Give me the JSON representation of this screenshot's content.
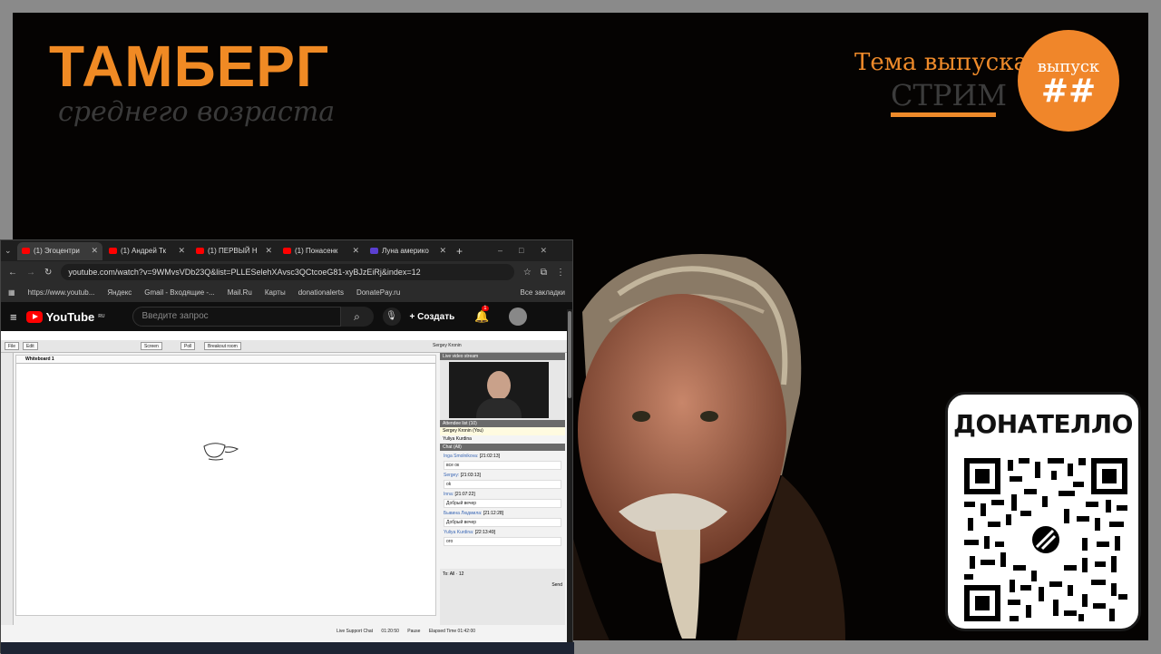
{
  "overlay": {
    "brand_title": "ТАМБЕРГ",
    "brand_subtitle": "среднего возраста",
    "topic_label": "Тема выпуска:",
    "topic_value": "СТРИМ",
    "badge_label": "выпуск",
    "badge_number": "##",
    "donate_title": "ДОНАТЕЛЛО"
  },
  "browser": {
    "tabs": [
      {
        "label": "(1) Эгоцентри",
        "active": true
      },
      {
        "label": "(1) Андрей Тк",
        "active": false
      },
      {
        "label": "(1) ПЕРВЫЙ Н",
        "active": false
      },
      {
        "label": "(1) Понасенк",
        "active": false
      },
      {
        "label": "Луна америко",
        "active": false
      }
    ],
    "url": "youtube.com/watch?v=9WMvsVDb23Q&list=PLLESelehXAvsc3QCtcoeG81-xyBJzEiRj&index=12",
    "bookmarks": [
      "https://www.youtub...",
      "Яндекс",
      "Gmail - Входящие -...",
      "Mail.Ru",
      "Карты",
      "donationalerts",
      "DonatePay.ru",
      "Все закладки"
    ]
  },
  "youtube": {
    "logo": "YouTube",
    "region": "RU",
    "search_placeholder": "Введите запрос",
    "create_label": "Создать",
    "notification_count": "1"
  },
  "whiteboard": {
    "toolbar": [
      "File",
      "Edit",
      "Screen",
      "Poll",
      "Breakout room"
    ],
    "tab": "Whiteboard 1",
    "user": "Sergey Kronin",
    "live_title": "Live video stream",
    "attendee_title": "Attendee list (10)",
    "attendees": [
      "Sergey Kronin (You)",
      "Yuliya Kurdina"
    ],
    "chat_title": "Chat (All)",
    "chat": [
      {
        "name": "Inga Smolnikova:",
        "time": "[21:02:13]",
        "text": "все ок"
      },
      {
        "name": "Sergey:",
        "time": "[21:03:13]",
        "text": "ok"
      },
      {
        "name": "Inna:",
        "time": "[21:07:22]",
        "text": "Добрый вечер"
      },
      {
        "name": "Бывина Людмила:",
        "time": "[21:12:28]",
        "text": "Добрый вечер"
      },
      {
        "name": "Yuliya Kurdina:",
        "time": "[22:13:49]",
        "text": "ого"
      }
    ],
    "chat_to": "All",
    "send": "Send",
    "font_size": "12",
    "support": "Live Support Chat",
    "timer": "01:20:50",
    "pause": "Pause",
    "elapsed_label": "Elapsed Time",
    "elapsed": "01:42:00"
  }
}
